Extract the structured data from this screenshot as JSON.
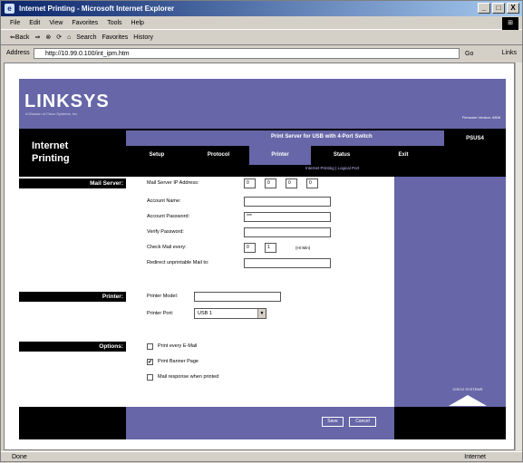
{
  "window": {
    "title": "Internet Printing - Microsoft Internet Explorer",
    "btn_min": "_",
    "btn_max": "□",
    "btn_close": "X"
  },
  "menubar": {
    "items": [
      "File",
      "Edit",
      "View",
      "Favorites",
      "Tools",
      "Help"
    ]
  },
  "toolbar": {
    "back": "⇐Back",
    "forward": "⇒",
    "stop": "⊗",
    "refresh": "⟳",
    "home": "⌂",
    "search": "Search",
    "favorites": "Favorites",
    "history": "History"
  },
  "addressbar": {
    "label": "Address",
    "url": "http://10.99.0.100/int_ipm.htm",
    "go": "Go",
    "links": "Links"
  },
  "page": {
    "brand": "LINKSYS",
    "brand_sub": "A Division of Cisco Systems, Inc.",
    "firmware": "Firmware Version: 6808",
    "app_title_line1": "Internet",
    "app_title_line2": "Printing",
    "product_name": "Print Server for USB with 4-Port Switch",
    "model": "PSUS4",
    "tabs": [
      "Setup",
      "Protocol",
      "Printer",
      "Status",
      "Exit"
    ],
    "active_tab": "Printer",
    "subnav": "Internet Printing | Logical Port"
  },
  "mail_server": {
    "section_label": "Mail Server:",
    "ip_label": "Mail Server IP Address:",
    "ip": [
      "0",
      "0",
      "0",
      "0"
    ],
    "account_name_label": "Account Name:",
    "account_name": "",
    "account_password_label": "Account Password:",
    "account_password": "***",
    "verify_password_label": "Verify Password:",
    "verify_password": "",
    "check_mail_label": "Check Mail every:",
    "check_mail_hours": "0",
    "check_mail_minutes": "1",
    "check_mail_unit": "(Hr:Min)",
    "redirect_label": "Redirect unprintable Mail to:",
    "redirect": ""
  },
  "printer": {
    "section_label": "Printer:",
    "model_label": "Printer Model:",
    "model": "",
    "port_label": "Printer Port:",
    "port": "USB 1"
  },
  "options": {
    "section_label": "Options:",
    "print_email": "Print every E-Mail",
    "print_email_checked": false,
    "print_banner": "Print Banner Page",
    "print_banner_checked": true,
    "mail_response": "Mail response when printed",
    "mail_response_checked": false
  },
  "buttons": {
    "save": "Save",
    "cancel": "Cancel"
  },
  "cisco": "CISCO SYSTEMS",
  "status": {
    "text": "Done",
    "zone": "Internet"
  },
  "colors": {
    "accent": "#6666a8",
    "dark": "#000000"
  }
}
